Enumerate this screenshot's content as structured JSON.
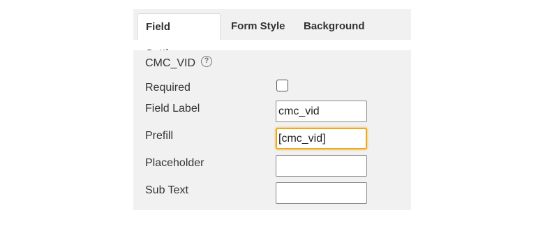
{
  "tabs": [
    {
      "label": "Field Settings",
      "active": true
    },
    {
      "label": "Form Style",
      "active": false
    },
    {
      "label": "Background",
      "active": false
    }
  ],
  "field": {
    "name": "CMC_VID",
    "help_icon": "question-circle-icon",
    "help_glyph": "?"
  },
  "settings": {
    "required_label": "Required",
    "required_checked": false,
    "field_label_label": "Field Label",
    "field_label_value": "cmc_vid",
    "prefill_label": "Prefill",
    "prefill_value": "[cmc_vid]",
    "placeholder_label": "Placeholder",
    "placeholder_value": "",
    "subtext_label": "Sub Text",
    "subtext_value": ""
  },
  "colors": {
    "panel_background": "#f1f1f1",
    "focus_outline": "#f0a817"
  }
}
